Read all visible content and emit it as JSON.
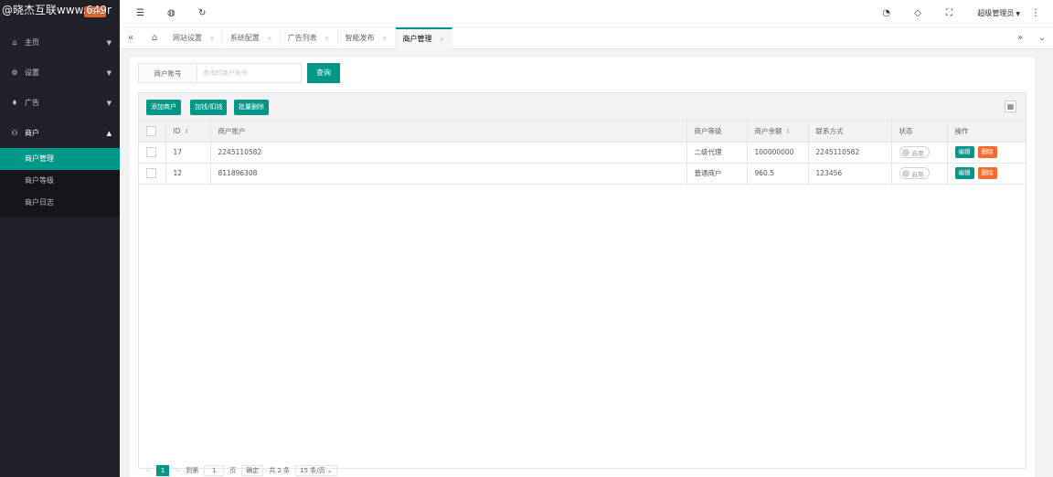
{
  "watermark": "@晓杰互联www.649r",
  "logo": {
    "version": "V1.0"
  },
  "sidebar": {
    "items": [
      {
        "icon": "⌂",
        "label": "主页",
        "arrow": "▼"
      },
      {
        "icon": "⚙",
        "label": "设置",
        "arrow": "▼"
      },
      {
        "icon": "♦",
        "label": "广告",
        "arrow": "▼"
      },
      {
        "icon": "⚇",
        "label": "商户",
        "arrow": "▲"
      }
    ],
    "submenu": [
      "商户管理",
      "商户等级",
      "商户日志"
    ]
  },
  "header": {
    "icons": [
      "☰",
      "◍",
      "↻"
    ],
    "right_icons": [
      "◔",
      "◇",
      "⛶"
    ],
    "user": "超级管理员",
    "more": "⋮"
  },
  "tabs": {
    "left_nav": "«",
    "home": "⌂",
    "items": [
      "网站设置",
      "系统配置",
      "广告列表",
      "智能发布",
      "商户管理"
    ],
    "close": "×",
    "right_nav": "»",
    "dropdown": "⌄"
  },
  "search": {
    "label": "商户账号",
    "placeholder": "查询的商户账号",
    "button": "查询"
  },
  "toolbar": {
    "add": "添加商户",
    "adjust": "加钱/扣钱",
    "batch_delete": "批量删除",
    "grid": "▦"
  },
  "table": {
    "headers": [
      "ID",
      "商户账户",
      "商户等级",
      "商户余额",
      "联系方式",
      "状态",
      "操作"
    ],
    "rows": [
      {
        "id": "17",
        "account": "2245110582",
        "level": "二级代理",
        "balance": "100000000",
        "contact": "2245110582",
        "status": "启用"
      },
      {
        "id": "12",
        "account": "811896308",
        "level": "普通商户",
        "balance": "960.5",
        "contact": "123456",
        "status": "启用"
      }
    ],
    "edit": "编辑",
    "delete": "删除"
  },
  "pager": {
    "prev": "<",
    "current": "1",
    "next": ">",
    "goto": "到第",
    "page_input": "1",
    "page_unit": "页",
    "confirm": "确定",
    "total": "共 2 条",
    "per_page": "15 条/页"
  }
}
